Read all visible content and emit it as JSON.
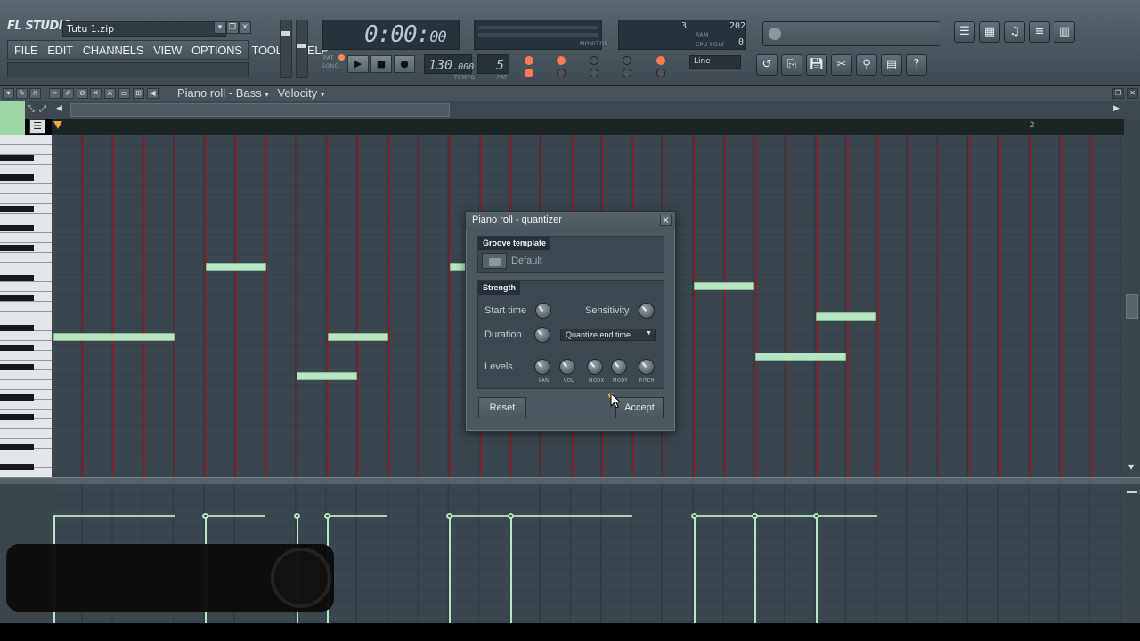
{
  "app": {
    "logo": "FL STUDIO",
    "filename": "Tutu 1.zip",
    "menu": [
      "FILE",
      "EDIT",
      "CHANNELS",
      "VIEW",
      "OPTIONS",
      "TOOLS",
      "HELP"
    ],
    "time": "0:00",
    "time_small": "00",
    "tempo": "130",
    "tempo_small": ".000",
    "pattern": "5",
    "cpu_val1": "3",
    "cpu_val2": "202",
    "cpu_val3": "0",
    "line_mode": "Line",
    "labels": {
      "pat": "PAT",
      "song": "SONG",
      "tempo": "TEMPO",
      "pat_small": "PAT",
      "monitor": "MONITOR",
      "cpu": "CPU",
      "poly": "POLY",
      "ram": "RAM"
    }
  },
  "pianoroll": {
    "title": "Piano roll - Bass",
    "velocity": "Velocity",
    "bar_number": "2"
  },
  "dialog": {
    "title": "Piano roll - quantizer",
    "groove_label": "Groove template",
    "groove_value": "Default",
    "strength_label": "Strength",
    "start_time": "Start time",
    "sensitivity": "Sensitivity",
    "duration": "Duration",
    "duration_option": "Quantize end time",
    "levels": "Levels",
    "knob_labels": [
      "PAN",
      "VOL",
      "MODX",
      "MODY",
      "PITCH"
    ],
    "reset": "Reset",
    "accept": "Accept"
  },
  "colors": {
    "note": "#b9e6c2",
    "grid_bar_line": "#8c1f24",
    "grid_bg": "#3a474f"
  }
}
